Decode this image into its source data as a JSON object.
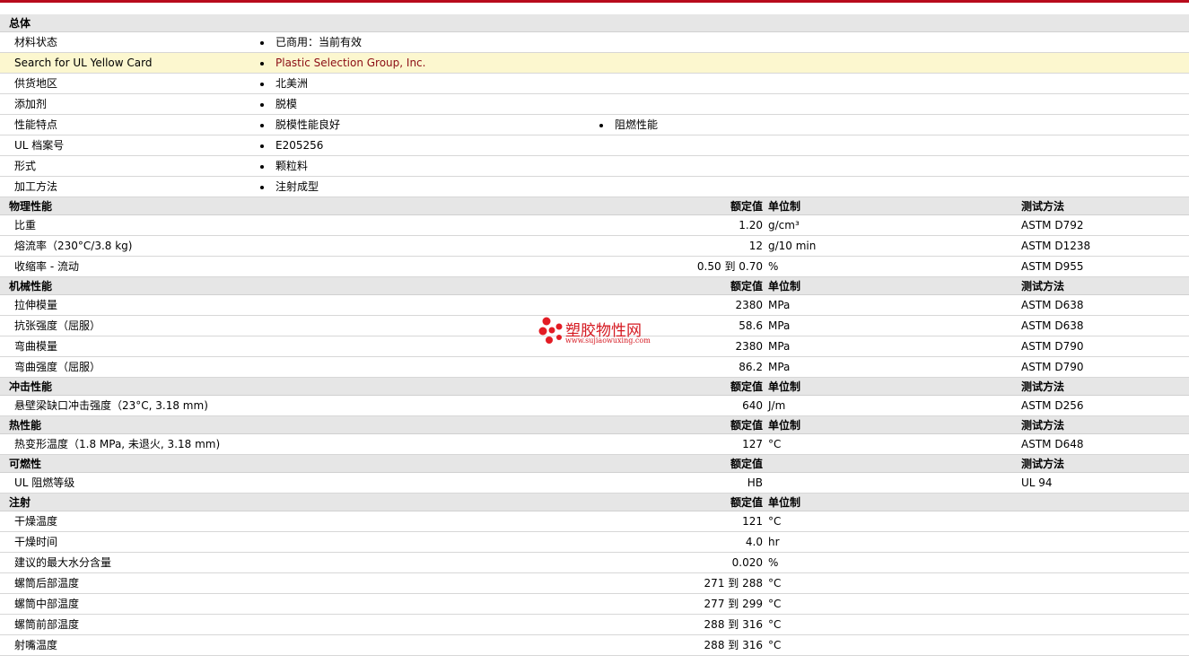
{
  "general": {
    "title": "总体",
    "rows": [
      {
        "label": "材料状态",
        "values": [
          "已商用：当前有效"
        ]
      },
      {
        "label": "Search for UL Yellow Card",
        "values": [
          "Plastic Selection Group, Inc."
        ],
        "highlight": true,
        "link": true
      },
      {
        "label": "供货地区",
        "values": [
          "北美洲"
        ]
      },
      {
        "label": "添加剂",
        "values": [
          "脱模"
        ]
      },
      {
        "label": "性能特点",
        "values": [
          "脱模性能良好",
          "阻燃性能"
        ]
      },
      {
        "label": "UL 档案号",
        "values": [
          "E205256"
        ]
      },
      {
        "label": "形式",
        "values": [
          "颗粒料"
        ]
      },
      {
        "label": "加工方法",
        "values": [
          "注射成型"
        ]
      }
    ]
  },
  "sections": [
    {
      "title": "物理性能",
      "value_header": "额定值",
      "unit_header": "单位制",
      "test_header": "测试方法",
      "rows": [
        {
          "label": "比重",
          "value": "1.20",
          "unit": "g/cm³",
          "test": "ASTM D792"
        },
        {
          "label": "熔流率（230°C/3.8 kg)",
          "value": "12",
          "unit": "g/10 min",
          "test": "ASTM D1238"
        },
        {
          "label": "收缩率 - 流动",
          "value": "0.50 到  0.70",
          "unit": "%",
          "test": "ASTM D955"
        }
      ]
    },
    {
      "title": "机械性能",
      "value_header": "额定值",
      "unit_header": "单位制",
      "test_header": "测试方法",
      "rows": [
        {
          "label": "拉伸模量",
          "value": "2380",
          "unit": "MPa",
          "test": "ASTM D638"
        },
        {
          "label": "抗张强度（屈服）",
          "value": "58.6",
          "unit": "MPa",
          "test": "ASTM D638"
        },
        {
          "label": "弯曲模量",
          "value": "2380",
          "unit": "MPa",
          "test": "ASTM D790"
        },
        {
          "label": "弯曲强度（屈服）",
          "value": "86.2",
          "unit": "MPa",
          "test": "ASTM D790"
        }
      ]
    },
    {
      "title": "冲击性能",
      "value_header": "额定值",
      "unit_header": "单位制",
      "test_header": "测试方法",
      "rows": [
        {
          "label": "悬壁梁缺口冲击强度（23°C, 3.18 mm)",
          "value": "640",
          "unit": "J/m",
          "test": "ASTM D256"
        }
      ]
    },
    {
      "title": "热性能",
      "value_header": "额定值",
      "unit_header": "单位制",
      "test_header": "测试方法",
      "rows": [
        {
          "label": "热变形温度（1.8 MPa, 未退火, 3.18 mm)",
          "value": "127",
          "unit": "°C",
          "test": "ASTM D648"
        }
      ]
    },
    {
      "title": "可燃性",
      "value_header": "额定值",
      "unit_header": "",
      "test_header": "测试方法",
      "rows": [
        {
          "label": "UL 阻燃等级",
          "value": "HB",
          "unit": "",
          "test": "UL 94"
        }
      ]
    },
    {
      "title": "注射",
      "value_header": "额定值",
      "unit_header": "单位制",
      "test_header": "",
      "rows": [
        {
          "label": "干燥温度",
          "value": "121",
          "unit": "°C",
          "test": ""
        },
        {
          "label": "干燥时间",
          "value": "4.0",
          "unit": "hr",
          "test": ""
        },
        {
          "label": "建议的最大水分含量",
          "value": "0.020",
          "unit": "%",
          "test": ""
        },
        {
          "label": "螺筒后部温度",
          "value": "271 到  288",
          "unit": "°C",
          "test": ""
        },
        {
          "label": "螺筒中部温度",
          "value": "277 到  299",
          "unit": "°C",
          "test": ""
        },
        {
          "label": "螺筒前部温度",
          "value": "288 到  316",
          "unit": "°C",
          "test": ""
        },
        {
          "label": "射嘴温度",
          "value": "288 到  316",
          "unit": "°C",
          "test": ""
        }
      ]
    }
  ],
  "watermark": {
    "name": "塑胶物性网",
    "url": "www.sujiaowuxing.com"
  },
  "colors": {
    "accent": "#b80b1c",
    "section_bg": "#e6e6e6",
    "highlight_bg": "#fcf7cf",
    "link": "#8b0c14",
    "watermark": "#d51820"
  }
}
